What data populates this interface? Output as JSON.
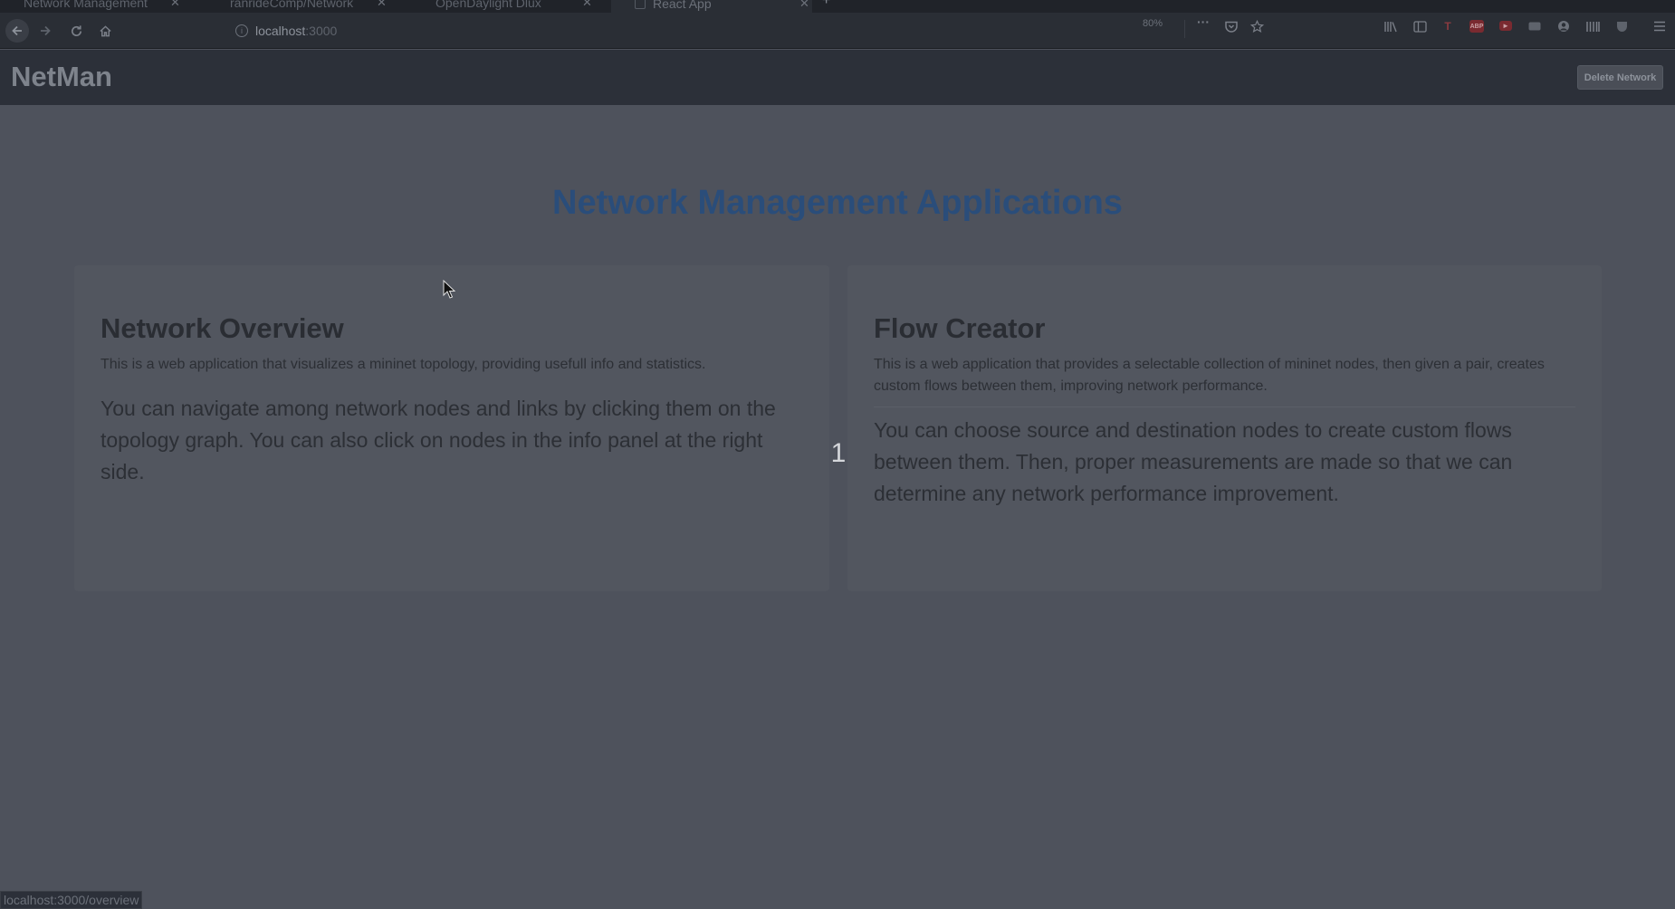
{
  "browser": {
    "tabs": [
      {
        "title": "Network Management",
        "active": false
      },
      {
        "title": "ranrideComp/Network",
        "active": false
      },
      {
        "title": "OpenDaylight Dlux",
        "active": false
      },
      {
        "title": "React App",
        "active": true
      }
    ],
    "close_glyph": "✕",
    "new_tab_glyph": "+",
    "url_host": "localhost",
    "url_port": ":3000",
    "zoom": "80%"
  },
  "header": {
    "brand": "NetMan",
    "delete_button": "Delete Network"
  },
  "main": {
    "title": "Network Management Applications",
    "cards": [
      {
        "title": "Network Overview",
        "description": "This is a web application that visualizes a mininet topology, providing usefull info and statistics.",
        "body": "You can navigate among network nodes and links by clicking them on the topology graph. You can also click on nodes in the info panel at the right side."
      },
      {
        "title": "Flow Creator",
        "description": "This is a web application that provides a selectable collection of mininet nodes, then given a pair, creates custom flows between them, improving network performance.",
        "body": "You can choose source and destination nodes to create custom flows between them. Then, proper measurements are made so that we can determine any network performance improvement."
      }
    ],
    "marker": "1"
  },
  "status_bar": {
    "text": "localhost:3000/overview"
  },
  "colors": {
    "page_background": "#4e525c",
    "header_background": "#2c3039",
    "title_accent": "#2a4d7a"
  }
}
